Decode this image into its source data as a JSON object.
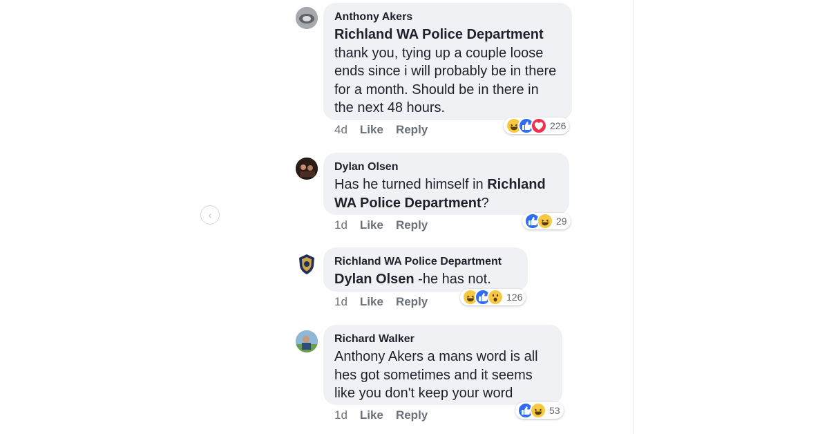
{
  "nav": {
    "prev_icon": "‹"
  },
  "colors": {
    "bubble": "#f0f1f4",
    "like": "#2e6df3",
    "love": "#f0304e",
    "emoji": "#f7c943"
  },
  "comments": [
    {
      "author": "Anthony Akers",
      "mention": "Richland WA Police Department",
      "text": "thank you, tying up a couple loose ends since i will probably be in there for a month. Should be in there in the next 48 hours.",
      "time": "4d",
      "like": "Like",
      "reply": "Reply",
      "reactions": [
        "haha",
        "like",
        "love"
      ],
      "reaction_count": "226"
    },
    {
      "author": "Dylan Olsen",
      "text_before": "Has he turned himself in ",
      "mention": "Richland WA Police Department",
      "text_after": "?",
      "time": "1d",
      "like": "Like",
      "reply": "Reply",
      "reactions": [
        "like",
        "haha"
      ],
      "reaction_count": "29"
    },
    {
      "author": "Richland WA Police Department",
      "mention": "Dylan Olsen",
      "text": " -he has not.",
      "time": "1d",
      "like": "Like",
      "reply": "Reply",
      "reactions": [
        "haha",
        "like",
        "wow"
      ],
      "reaction_count": "126"
    },
    {
      "author": "Richard Walker",
      "text": "Anthony Akers a mans word is all hes got sometimes and it seems like you don't keep your word",
      "time": "1d",
      "like": "Like",
      "reply": "Reply",
      "reactions": [
        "like",
        "haha"
      ],
      "reaction_count": "53"
    }
  ]
}
